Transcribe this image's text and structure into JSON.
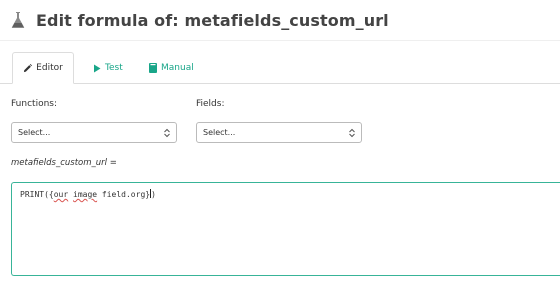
{
  "header": {
    "title": "Edit formula of: metafields_custom_url",
    "icon": "flask-icon"
  },
  "tabs": [
    {
      "label": "Editor",
      "icon": "pencil-icon",
      "active": true
    },
    {
      "label": "Test",
      "icon": "play-icon",
      "active": false
    },
    {
      "label": "Manual",
      "icon": "book-icon",
      "active": false
    }
  ],
  "functions": {
    "label": "Functions:",
    "selected": "Select..."
  },
  "fields": {
    "label": "Fields:",
    "selected": "Select..."
  },
  "formula": {
    "label": "metafields_custom_url =",
    "code": {
      "prefix": "PRINT({",
      "word1": "our",
      "space1": " ",
      "word2": "image",
      "rest": " field.org}",
      "suffix": ")"
    }
  },
  "colors": {
    "accent": "#19a689",
    "editor_border": "#38b498",
    "error_underline": "#d9534f"
  }
}
